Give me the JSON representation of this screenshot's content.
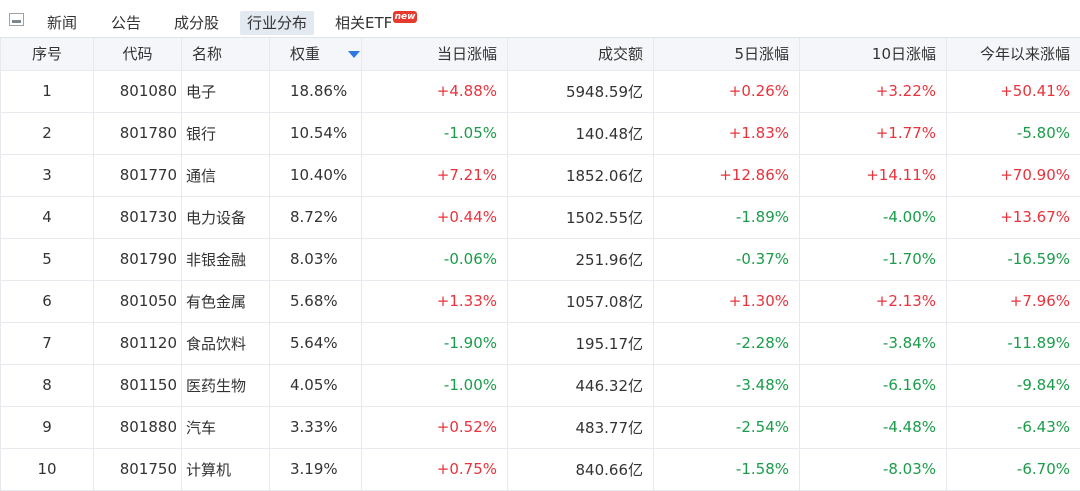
{
  "tabs": [
    {
      "label": "新闻",
      "active": false
    },
    {
      "label": "公告",
      "active": false
    },
    {
      "label": "成分股",
      "active": false
    },
    {
      "label": "行业分布",
      "active": true
    },
    {
      "label": "相关ETF",
      "active": false,
      "badge": "new"
    }
  ],
  "icons": {
    "collapse": "collapse-panel-icon",
    "sort": "sort-descending-arrow-icon"
  },
  "colors": {
    "up": "#e8333c",
    "down": "#1a9c4a",
    "active_tab": "#e3e9f1",
    "sort_arrow": "#2b78e4"
  },
  "table": {
    "columns": [
      "序号",
      "代码",
      "名称",
      "权重",
      "当日涨幅",
      "成交额",
      "5日涨幅",
      "10日涨幅",
      "今年以来涨幅"
    ],
    "sorted_by": "权重",
    "rows": [
      [
        "1",
        "801080",
        "电子",
        "18.86%",
        "+4.88%",
        "5948.59亿",
        "+0.26%",
        "+3.22%",
        "+50.41%"
      ],
      [
        "2",
        "801780",
        "银行",
        "10.54%",
        "-1.05%",
        "140.48亿",
        "+1.83%",
        "+1.77%",
        "-5.80%"
      ],
      [
        "3",
        "801770",
        "通信",
        "10.40%",
        "+7.21%",
        "1852.06亿",
        "+12.86%",
        "+14.11%",
        "+70.90%"
      ],
      [
        "4",
        "801730",
        "电力设备",
        "8.72%",
        "+0.44%",
        "1502.55亿",
        "-1.89%",
        "-4.00%",
        "+13.67%"
      ],
      [
        "5",
        "801790",
        "非银金融",
        "8.03%",
        "-0.06%",
        "251.96亿",
        "-0.37%",
        "-1.70%",
        "-16.59%"
      ],
      [
        "6",
        "801050",
        "有色金属",
        "5.68%",
        "+1.33%",
        "1057.08亿",
        "+1.30%",
        "+2.13%",
        "+7.96%"
      ],
      [
        "7",
        "801120",
        "食品饮料",
        "5.64%",
        "-1.90%",
        "195.17亿",
        "-2.28%",
        "-3.84%",
        "-11.89%"
      ],
      [
        "8",
        "801150",
        "医药生物",
        "4.05%",
        "-1.00%",
        "446.32亿",
        "-3.48%",
        "-6.16%",
        "-9.84%"
      ],
      [
        "9",
        "801880",
        "汽车",
        "3.33%",
        "+0.52%",
        "483.77亿",
        "-2.54%",
        "-4.48%",
        "-6.43%"
      ],
      [
        "10",
        "801750",
        "计算机",
        "3.19%",
        "+0.75%",
        "840.66亿",
        "-1.58%",
        "-8.03%",
        "-6.70%"
      ]
    ]
  }
}
